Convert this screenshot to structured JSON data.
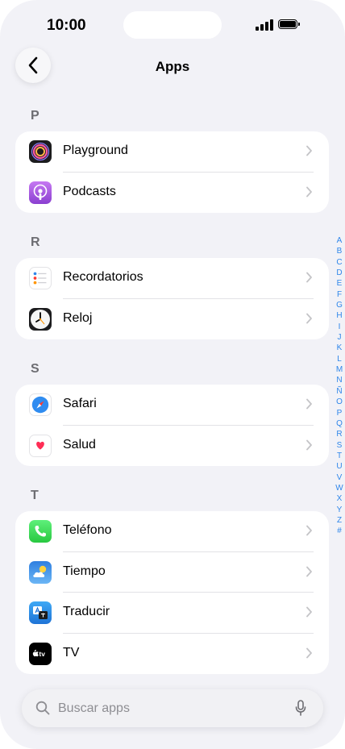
{
  "status_bar": {
    "time": "10:00"
  },
  "header": {
    "title": "Apps",
    "back_icon": "chevron-left-icon"
  },
  "sections": [
    {
      "letter": "P",
      "items": [
        {
          "label": "Playground",
          "icon": "playground-icon"
        },
        {
          "label": "Podcasts",
          "icon": "podcasts-icon"
        }
      ]
    },
    {
      "letter": "R",
      "items": [
        {
          "label": "Recordatorios",
          "icon": "reminders-icon"
        },
        {
          "label": "Reloj",
          "icon": "clock-icon"
        }
      ]
    },
    {
      "letter": "S",
      "items": [
        {
          "label": "Safari",
          "icon": "safari-icon"
        },
        {
          "label": "Salud",
          "icon": "health-icon"
        }
      ]
    },
    {
      "letter": "T",
      "items": [
        {
          "label": "Teléfono",
          "icon": "phone-icon"
        },
        {
          "label": "Tiempo",
          "icon": "weather-icon"
        },
        {
          "label": "Traducir",
          "icon": "translate-icon"
        },
        {
          "label": "TV",
          "icon": "tv-icon"
        }
      ]
    }
  ],
  "index_letters": [
    "A",
    "B",
    "C",
    "D",
    "E",
    "F",
    "G",
    "H",
    "I",
    "J",
    "K",
    "L",
    "M",
    "N",
    "Ñ",
    "O",
    "P",
    "Q",
    "R",
    "S",
    "T",
    "U",
    "V",
    "W",
    "X",
    "Y",
    "Z",
    "#"
  ],
  "search": {
    "placeholder": "Buscar apps",
    "icon": "search-icon",
    "mic_icon": "microphone-icon"
  },
  "tv_badge": "tv",
  "colors": {
    "accent": "#2f86ea",
    "background": "#f2f2f7",
    "card": "#ffffff",
    "secondary_text": "#8e8e93"
  }
}
